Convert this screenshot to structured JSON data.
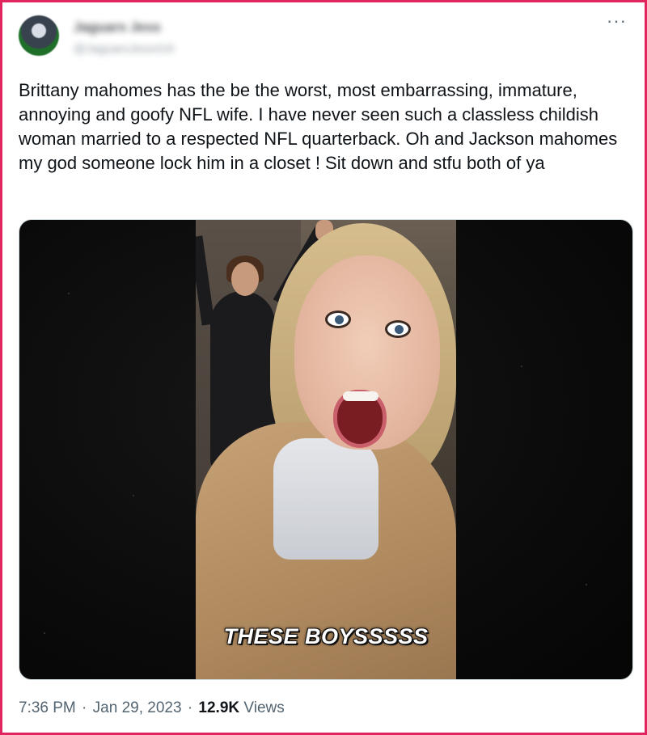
{
  "author": {
    "display_name": "Jaguars Jess",
    "handle": "@JaguarsJess416",
    "avatar_icon": "avatar-image"
  },
  "more_icon": "···",
  "tweet": {
    "text": "Brittany mahomes has the be the worst, most embarrassing, immature, annoying and goofy NFL wife. I have never seen such a classless childish woman married to a respected NFL quarterback. Oh and Jackson mahomes my god someone lock him in a closet ! Sit down and stfu both of ya"
  },
  "media": {
    "caption": "THESE BOYSSSSS"
  },
  "footer": {
    "time": "7:36 PM",
    "separator": "·",
    "date": "Jan 29, 2023",
    "views_count": "12.9K",
    "views_label": "Views"
  },
  "colors": {
    "frame_border": "#e0245e",
    "text_primary": "#0f1419",
    "text_secondary": "#536471"
  }
}
